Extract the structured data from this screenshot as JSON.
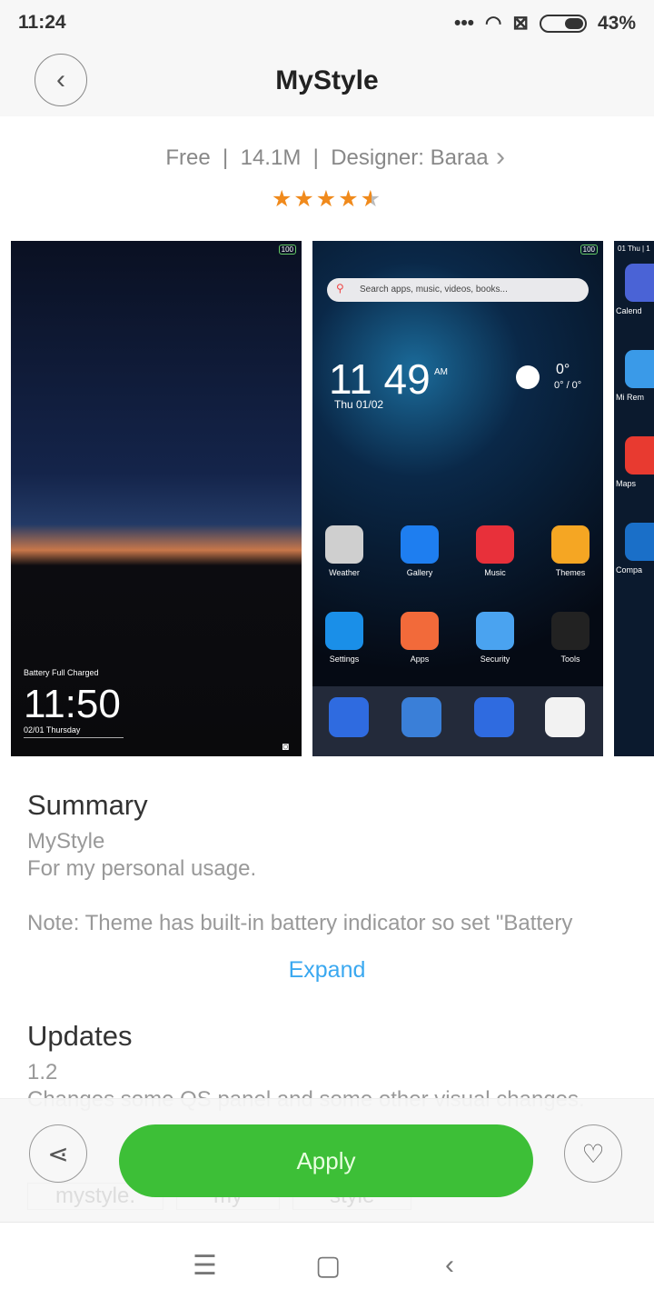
{
  "status": {
    "time": "11:24",
    "battery": "43%",
    "icons": [
      "more-dots-icon",
      "wifi-icon",
      "no-sim-icon",
      "battery-icon"
    ]
  },
  "header": {
    "title": "MyStyle"
  },
  "meta": {
    "price": "Free",
    "size": "14.1M",
    "designer": "Designer: Baraa",
    "rating": 4.5
  },
  "screens": {
    "lock": {
      "battery_badge": "100",
      "notice": "Battery Full Charged",
      "clock": "11:50",
      "date": "02/01  Thursday"
    },
    "home": {
      "battery_badge": "100",
      "search_placeholder": "Search apps, music, videos, books...",
      "clock": "11 49",
      "ampm": "AM",
      "date": "Thu 01/02",
      "temp": "0°",
      "range": "0° / 0°",
      "apps": [
        {
          "label": "Weather",
          "color": "#cfcfcf"
        },
        {
          "label": "Gallery",
          "color": "#1e7ef0"
        },
        {
          "label": "Music",
          "color": "#e8303a"
        },
        {
          "label": "Themes",
          "color": "#f5a623"
        },
        {
          "label": "Settings",
          "color": "#1a8fe8"
        },
        {
          "label": "Apps",
          "color": "#f26a3a"
        },
        {
          "label": "Security",
          "color": "#4aa3f0"
        },
        {
          "label": "Tools",
          "color": "#222222"
        }
      ]
    },
    "third": {
      "header": "01 Thu | 1",
      "apps": [
        "Calend",
        "Mi Rem",
        "Maps",
        "Compa"
      ]
    }
  },
  "summary": {
    "title": "Summary",
    "name": "MyStyle",
    "line1": "For my personal usage.",
    "note": "Note: Theme has built-in battery indicator so set \"Battery",
    "expand": "Expand"
  },
  "updates": {
    "title": "Updates",
    "version": "1.2",
    "text": "Changes some QS panel and some other visual changes."
  },
  "tags": [
    "mystyle.",
    "my",
    "style"
  ],
  "actions": {
    "apply": "Apply"
  },
  "colors": {
    "accent": "#3dbf37",
    "link": "#3aa8f0",
    "star": "#f08a1c"
  }
}
